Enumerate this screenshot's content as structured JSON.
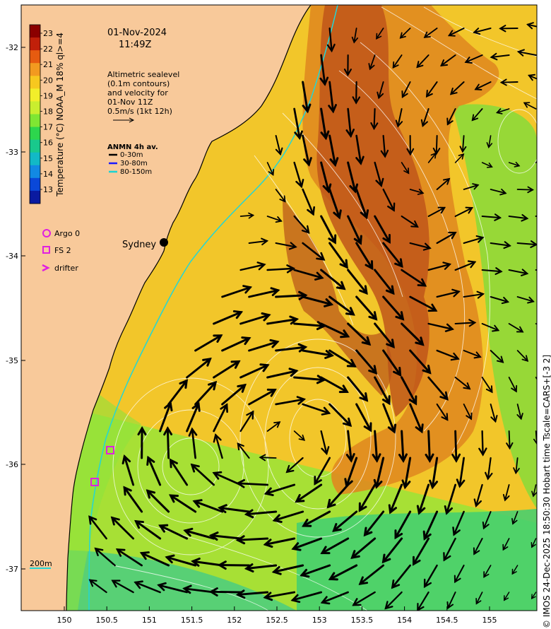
{
  "header": {
    "date": "01-Nov-2024",
    "time": "11:49Z"
  },
  "altimetry_note": {
    "lines": [
      "Altimetric sealevel",
      "(0.1m contours)",
      "and velocity for",
      "01-Nov 11Z",
      "0.5m/s (1kt 12h)"
    ]
  },
  "anmn_legend": {
    "title": "ANMN 4h av.",
    "items": [
      {
        "label": "0-30m",
        "color": "#000000"
      },
      {
        "label": "30-80m",
        "color": "#1a1aff"
      },
      {
        "label": "80-150m",
        "color": "#19d3d3"
      }
    ]
  },
  "platform_legend": {
    "items": [
      {
        "label": "Argo 0",
        "symbol": "circle",
        "color": "#e020e0"
      },
      {
        "label": "FS 2",
        "symbol": "square",
        "color": "#e020e0"
      },
      {
        "label": "drifter",
        "symbol": "chevron",
        "color": "#e020e0"
      }
    ]
  },
  "colorbar": {
    "label": "Temperature (°C) NOAA_M 18% ql>=4",
    "ticks": [
      "23",
      "22",
      "21",
      "20",
      "19",
      "18",
      "17",
      "16",
      "15",
      "14",
      "13"
    ],
    "colors": [
      "#8b0000",
      "#c1200a",
      "#e65b10",
      "#f29a20",
      "#f7c81f",
      "#f2ee2a",
      "#c9ee2f",
      "#7fe633",
      "#2dd64d",
      "#19c98c",
      "#12b9c6",
      "#1289e3",
      "#0a48d8",
      "#0a1aa0"
    ]
  },
  "map": {
    "city_label": "Sydney",
    "isobath_label": "200m",
    "lat_ticks": [
      "-32",
      "-33",
      "-34",
      "-35",
      "-36",
      "-37"
    ],
    "lon_ticks": [
      "150",
      "150.5",
      "151",
      "151.5",
      "152",
      "152.5",
      "153",
      "153.5",
      "154",
      "154.5",
      "155"
    ],
    "land_color": "#f8c99a",
    "fs_sites": [
      {
        "lon": 150.55,
        "lat": -35.85
      },
      {
        "lon": 150.37,
        "lat": -36.35
      }
    ]
  },
  "credit": "© IMOS 24-Dec-2025 18:50:30 Hobart time Tscale=CARS+[-3 2]"
}
